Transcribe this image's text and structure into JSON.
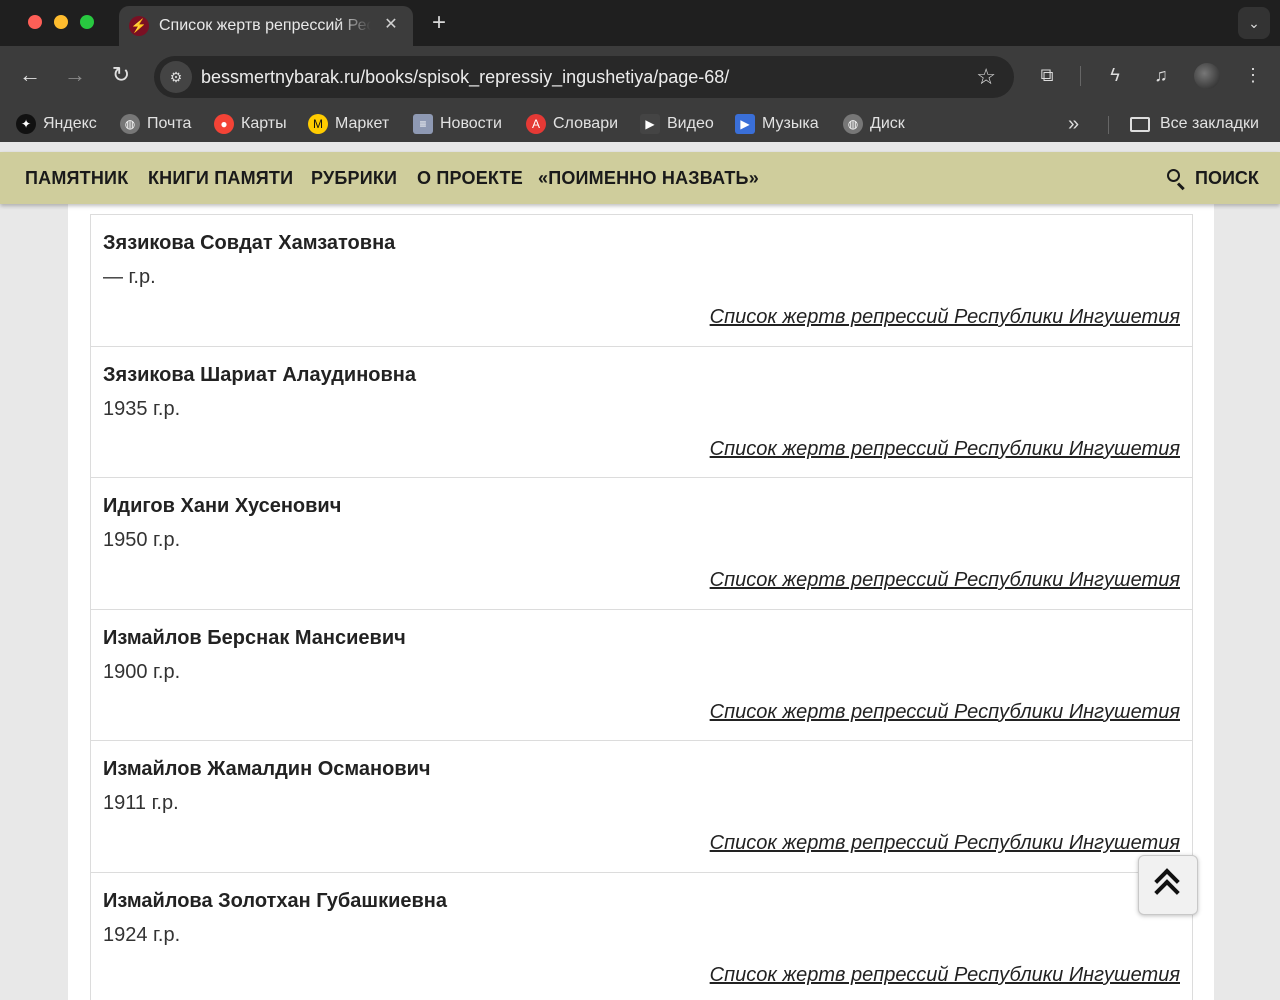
{
  "browser": {
    "tab": {
      "title": "Список жертв репрессий Республики Ингушетия"
    },
    "address": {
      "url": "bessmertnybarak.ru/books/spisok_repressiy_ingushetiya/page-68/"
    },
    "bookmarks": [
      {
        "label": "Яндекс",
        "icon": "yandex-icon",
        "color": "#111111"
      },
      {
        "label": "Почта",
        "icon": "globe-icon",
        "color": "#777777"
      },
      {
        "label": "Карты",
        "icon": "map-pin-icon",
        "color": "#f44336"
      },
      {
        "label": "Маркет",
        "icon": "market-icon",
        "color": "#ffcc00"
      },
      {
        "label": "Новости",
        "icon": "document-icon",
        "color": "#8e99b3"
      },
      {
        "label": "Словари",
        "icon": "dictionary-icon",
        "color": "#e53935"
      },
      {
        "label": "Видео",
        "icon": "play-icon",
        "color": "#444444"
      },
      {
        "label": "Музыка",
        "icon": "music-icon",
        "color": "#3a6fd8"
      },
      {
        "label": "Диск",
        "icon": "globe-icon",
        "color": "#777777"
      }
    ],
    "all_bookmarks": "Все закладки"
  },
  "site": {
    "nav": [
      "ПАМЯТНИК",
      "КНИГИ ПАМЯТИ",
      "РУБРИКИ",
      "О ПРОЕКТЕ",
      "«ПОИМЕННО НАЗВАТЬ»"
    ],
    "search_label": "ПОИСК",
    "nav_color": "#cfcd9c"
  },
  "entries": [
    {
      "name": "Зязикова Совдат Хамзатовна",
      "year": "— г.р.",
      "link": "Список жертв репрессий Республики Ингушетия"
    },
    {
      "name": "Зязикова Шариат Алаудиновна",
      "year": "1935 г.р.",
      "link": "Список жертв репрессий Республики Ингушетия"
    },
    {
      "name": "Идигов Хани Хусенович",
      "year": "1950 г.р.",
      "link": "Список жертв репрессий Республики Ингушетия"
    },
    {
      "name": "Измайлов Берснак Мансиевич",
      "year": "1900 г.р.",
      "link": "Список жертв репрессий Республики Ингушетия"
    },
    {
      "name": "Измайлов Жамалдин Османович",
      "year": "1911 г.р.",
      "link": "Список жертв репрессий Республики Ингушетия"
    },
    {
      "name": "Измайлова Золотхан Губашкиевна",
      "year": "1924 г.р.",
      "link": "Список жертв репрессий Республики Ингушетия"
    }
  ]
}
